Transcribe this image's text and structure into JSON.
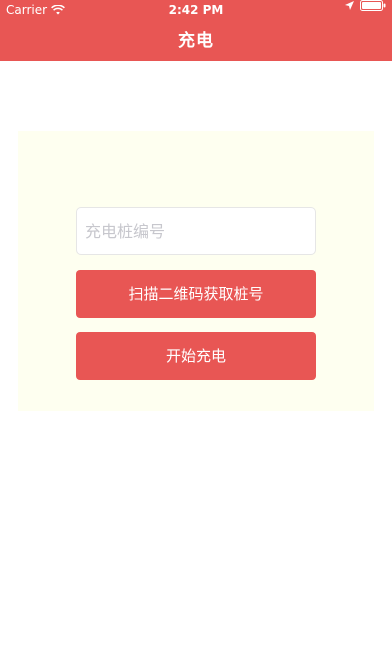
{
  "status_bar": {
    "carrier": "Carrier",
    "time": "2:42 PM",
    "icons": [
      "wifi-icon",
      "location-arrow-icon",
      "battery-icon"
    ]
  },
  "nav": {
    "title": "充电"
  },
  "form": {
    "pile_number_placeholder": "充电桩编号",
    "pile_number_value": "",
    "scan_button_label": "扫描二维码获取桩号",
    "start_button_label": "开始充电"
  },
  "colors": {
    "brand": "#e85654",
    "panel_background": "#fefff0",
    "page_background": "#ffffff"
  }
}
